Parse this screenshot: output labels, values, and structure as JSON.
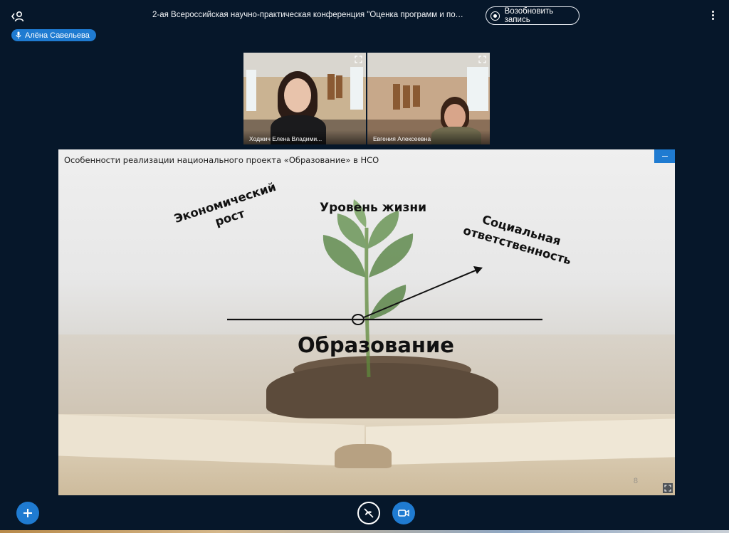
{
  "header": {
    "title": "2-ая Всероссийская научно-практическая конференция \"Оценка программ и политик в ...",
    "record_label": "Возобновить запись"
  },
  "talker": {
    "name": "Алёна Савельева"
  },
  "videos": [
    {
      "name": "Ходжич Елена Владими..."
    },
    {
      "name": "Евгения Алексеевна"
    }
  ],
  "presentation": {
    "header": "Особенности реализации  национального проекта «Образование» в НСО",
    "slide": {
      "econ_line1": "Экономический",
      "econ_line2": "рост",
      "life": "Уровень жизни",
      "social_line1": "Социальная",
      "social_line2": "ответственность",
      "center": "Образование"
    },
    "page_number": "8"
  },
  "colors": {
    "background": "#06172a",
    "accent": "#1f7bd1"
  },
  "icons": {
    "users": "user-list-icon",
    "record": "record-icon",
    "options": "kebab-menu-icon",
    "mic": "microphone-icon",
    "actions": "plus-icon",
    "audio": "phone-hangup-icon",
    "video": "video-camera-icon",
    "fullscreen": "fullscreen-icon",
    "minimize": "minimize-icon"
  }
}
